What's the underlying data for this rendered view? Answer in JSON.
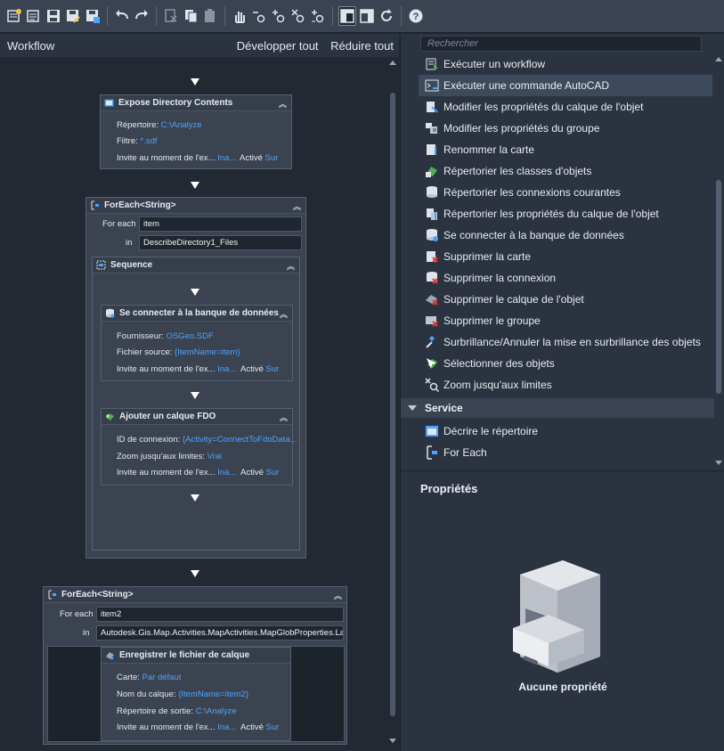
{
  "left_panel": {
    "title": "Workflow",
    "expand_all": "Développer tout",
    "collapse_all": "Réduire tout"
  },
  "workflow": {
    "expose": {
      "title": "Expose Directory Contents",
      "dir_label": "Répertoire:",
      "dir_value": "C:\\Analyze",
      "filter_label": "Filtre:",
      "filter_value": "*.sdf",
      "prompt_label": "Invite au moment de l'ex...",
      "prompt_value": "Ina...",
      "active_label": "Activé",
      "active_value": "Sur"
    },
    "foreach1": {
      "title": "ForEach<String>",
      "for_each_label": "For each",
      "for_each_value": "item",
      "in_label": "in",
      "in_value": "DescribeDirectory1_Files"
    },
    "sequence": {
      "title": "Sequence"
    },
    "connect": {
      "title": "Se connecter à la banque de données",
      "provider_label": "Fournisseur:",
      "provider_value": "OSGeo.SDF",
      "source_label": "Fichier source:",
      "source_value": "{ItemName=item}",
      "prompt_label": "Invite au moment de l'ex...",
      "prompt_value": "Ina...",
      "active_label": "Activé",
      "active_value": "Sur"
    },
    "addlayer": {
      "title": "Ajouter un calque FDO",
      "conn_label": "ID de connexion:",
      "conn_value": "{Activity=ConnectToFdoData...",
      "zoom_label": "Zoom jusqu'aux limites:",
      "zoom_value": "Vrai",
      "prompt_label": "Invite au moment de l'ex...",
      "prompt_value": "Ina...",
      "active_label": "Activé",
      "active_value": "Sur"
    },
    "foreach2": {
      "title": "ForEach<String>",
      "for_each_label": "For each",
      "for_each_value": "item2",
      "in_label": "in",
      "in_value": "Autodesk.Gis.Map.Activities.MapActivities.MapGlobProperties.Layers"
    },
    "savelayer": {
      "title": "Enregistrer le fichier de calque",
      "map_label": "Carte:",
      "map_value": "Par défaut",
      "layer_label": "Nom du calque:",
      "layer_value": "{ItemName=item2}",
      "outdir_label": "Répertoire de sortie:",
      "outdir_value": "C:\\Analyze",
      "prompt_label": "Invite au moment de l'ex...",
      "prompt_value": "Ina...",
      "active_label": "Activé",
      "active_value": "Sur"
    }
  },
  "right_panel": {
    "search_placeholder": "Rechercher",
    "items": [
      {
        "label": "Exécuter un workflow",
        "icon": "run-workflow-icon"
      },
      {
        "label": "Exécuter une commande AutoCAD",
        "icon": "run-command-icon",
        "selected": true
      },
      {
        "label": "Modifier les propriétés du calque de l'objet",
        "icon": "layer-props-icon"
      },
      {
        "label": "Modifier les propriétés du groupe",
        "icon": "group-props-icon"
      },
      {
        "label": "Renommer la carte",
        "icon": "rename-map-icon"
      },
      {
        "label": "Répertorier les classes d'objets",
        "icon": "list-classes-icon"
      },
      {
        "label": "Répertorier les connexions courantes",
        "icon": "list-connections-icon"
      },
      {
        "label": "Répertorier les propriétés du calque de l'objet",
        "icon": "list-layer-props-icon"
      },
      {
        "label": "Se connecter à la banque de données",
        "icon": "connect-datastore-icon"
      },
      {
        "label": "Supprimer la carte",
        "icon": "delete-map-icon"
      },
      {
        "label": "Supprimer la connexion",
        "icon": "delete-connection-icon"
      },
      {
        "label": "Supprimer le calque de l'objet",
        "icon": "delete-layer-icon"
      },
      {
        "label": "Supprimer le groupe",
        "icon": "delete-group-icon"
      },
      {
        "label": "Surbrillance/Annuler la mise en surbrillance des objets",
        "icon": "highlight-icon"
      },
      {
        "label": "Sélectionner des objets",
        "icon": "select-objects-icon"
      },
      {
        "label": "Zoom jusqu'aux limites",
        "icon": "zoom-extents-icon"
      }
    ],
    "category": "Service",
    "service_items": [
      {
        "label": "Décrire le répertoire",
        "icon": "describe-directory-icon"
      },
      {
        "label": "For Each",
        "icon": "for-each-icon"
      }
    ],
    "properties_title": "Propriétés",
    "no_properties": "Aucune propriété"
  },
  "colors": {
    "accent_value": "#4da3ff",
    "background": "#222933",
    "panel": "#2b3340"
  }
}
